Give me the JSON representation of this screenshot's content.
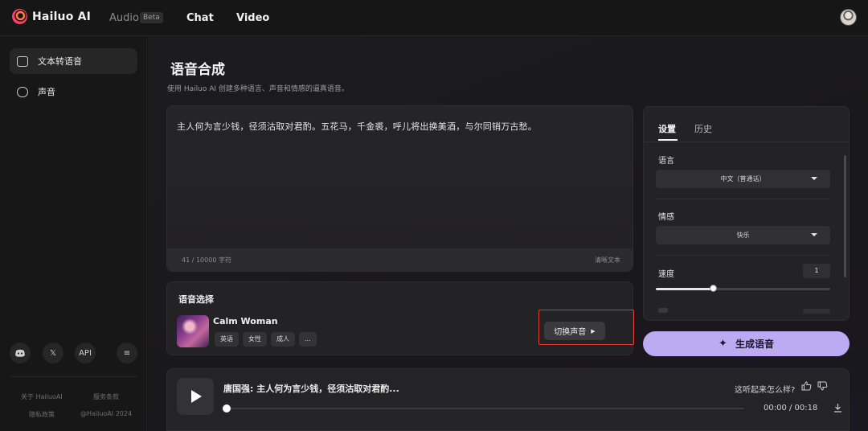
{
  "topbar": {
    "logo_text": "Hailuo AI",
    "nav": {
      "audio": "Audio",
      "beta": "Beta",
      "chat": "Chat",
      "video": "Video"
    }
  },
  "sidebar": {
    "items": [
      {
        "label": "文本转语音",
        "icon": "text-to-speech-icon",
        "active": true
      },
      {
        "label": "声音",
        "icon": "voice-bubble-icon",
        "active": false
      }
    ],
    "social": [
      {
        "icon": "discord-icon",
        "label": ""
      },
      {
        "icon": "x-icon",
        "label": "𝕏"
      },
      {
        "icon": "api-icon",
        "label": "API"
      },
      {
        "icon": "collapse-icon",
        "label": "≡"
      }
    ],
    "footer": {
      "about": "关于 HailuoAI",
      "terms": "服务条款",
      "privacy": "隐私政策",
      "copyright": "@HailuoAI 2024"
    }
  },
  "main": {
    "title": "语音合成",
    "subtitle": "使用 Hailuo AI 创建多种语言、声音和情感的逼真语音。",
    "text_input": {
      "content": "主人何为言少钱，径须沽取对君酌。五花马，千金裘，呼儿将出换美酒，与尔同销万古愁。",
      "char_count": "41 / 10000 字符",
      "clear_label": "清晰文本"
    },
    "voice_select": {
      "title": "语音选择",
      "voice_name": "Calm Woman",
      "tags": [
        "英语",
        "女性",
        "成人",
        "..."
      ],
      "switch_label": "切换声音",
      "switch_arrow": "▶"
    },
    "settings": {
      "tabs": [
        "设置",
        "历史"
      ],
      "language_label": "语言",
      "language_value": "中文（普通话）",
      "emotion_label": "情感",
      "emotion_value": "快乐",
      "speed_label": "速度",
      "speed_value": "1",
      "speed_fraction": 0.33
    },
    "generate_label": "生成语音",
    "player": {
      "track_title": "唐国强: 主人何为言少钱，径须沽取对君酌...",
      "rate_question": "这听起来怎么样?",
      "time": "00:00 / 00:18",
      "progress": 0.0
    }
  }
}
